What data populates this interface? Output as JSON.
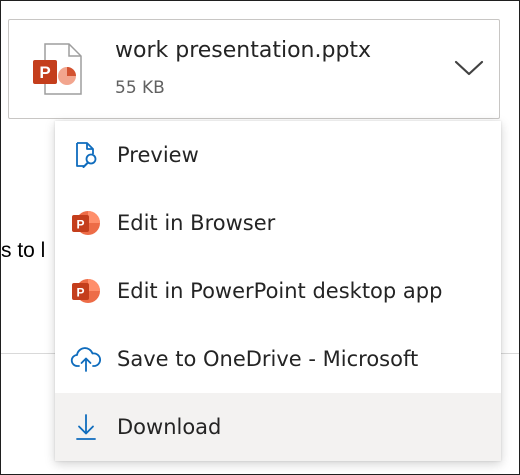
{
  "background": {
    "body_fragment": "s to l"
  },
  "attachment": {
    "file_name": "work presentation.pptx",
    "file_size": "55 KB",
    "file_icon": "powerpoint-file-icon",
    "expand_icon": "chevron-down-icon"
  },
  "menu": {
    "items": [
      {
        "label": "Preview",
        "icon": "preview-document-icon"
      },
      {
        "label": "Edit in Browser",
        "icon": "powerpoint-icon"
      },
      {
        "label": "Edit in PowerPoint desktop app",
        "icon": "powerpoint-icon"
      },
      {
        "label": "Save to OneDrive - Microsoft",
        "icon": "cloud-upload-icon"
      },
      {
        "label": "Download",
        "icon": "download-icon"
      }
    ],
    "highlighted_item": "Download"
  },
  "colors": {
    "accent": "#0f6cbd",
    "powerpoint": "#c43e1c",
    "hover": "#f3f2f1"
  }
}
